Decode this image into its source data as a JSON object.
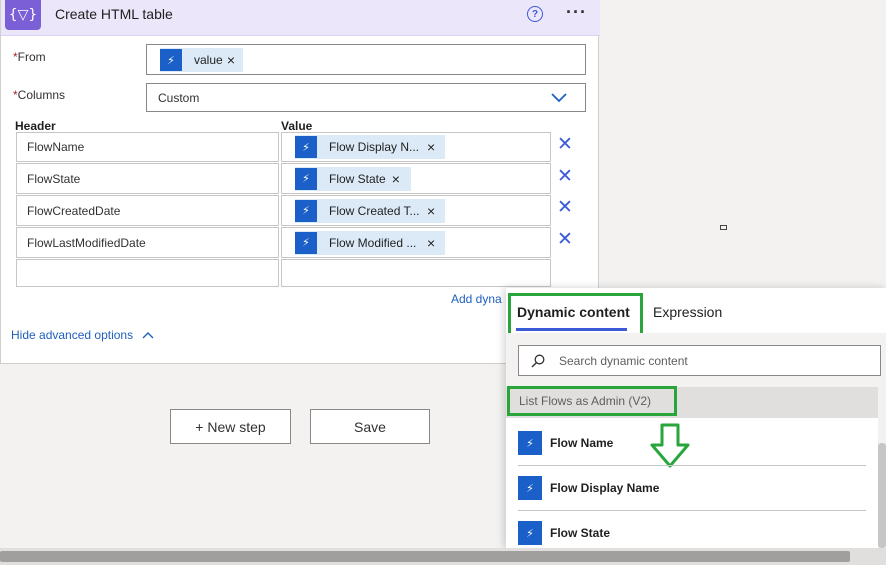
{
  "action": {
    "title": "Create HTML table",
    "help_glyph": "?",
    "more_glyph": "···",
    "icon_glyph": "{▽}",
    "from_label": "From",
    "required_mark": "*",
    "from_token": "value",
    "columns_label": "Columns",
    "columns_value": "Custom",
    "header_col": "Header",
    "value_col": "Value",
    "rows": [
      {
        "header": "FlowName",
        "value": "Flow Display N..."
      },
      {
        "header": "FlowState",
        "value": "Flow State"
      },
      {
        "header": "FlowCreatedDate",
        "value": "Flow Created T..."
      },
      {
        "header": "FlowLastModifiedDate",
        "value": "Flow Modified ..."
      }
    ],
    "add_dynamic": "Add dyna",
    "hide_advanced": "Hide advanced options"
  },
  "buttons": {
    "new_step": "+ New step",
    "save": "Save"
  },
  "panel": {
    "tab_dynamic": "Dynamic content",
    "tab_expression": "Expression",
    "search_placeholder": "Search dynamic content",
    "group_label": "List Flows as Admin (V2)",
    "items": [
      "Flow Name",
      "Flow Display Name",
      "Flow State"
    ]
  },
  "colors": {
    "accent": "#3b5ad8",
    "highlight": "#29a63b",
    "token": "#1b60c8",
    "header_bg": "#ece6fb"
  }
}
